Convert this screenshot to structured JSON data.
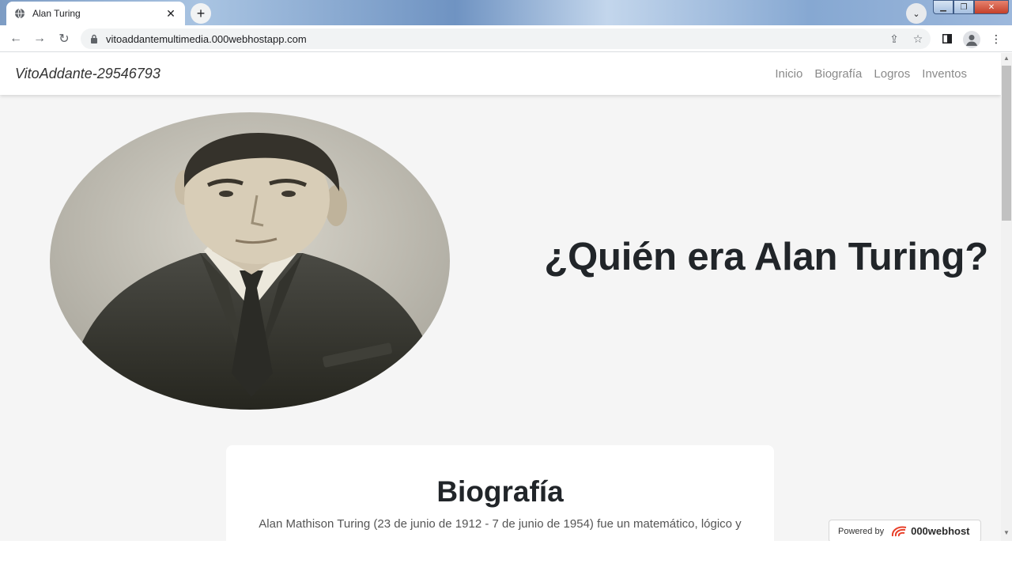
{
  "browser": {
    "tab_title": "Alan Turing",
    "tab_close": "✕",
    "new_tab": "+",
    "url": "vitoaddantemultimedia.000webhostapp.com"
  },
  "site": {
    "brand": "VitoAddante-29546793",
    "nav": [
      "Inicio",
      "Biografía",
      "Logros",
      "Inventos"
    ],
    "hero_title": "¿Quién era Alan Turing?",
    "bio_heading": "Biografía",
    "bio_text": "Alan Mathison Turing (23 de junio de 1912 - 7 de junio de 1954) fue un matemático, lógico y"
  },
  "badge": {
    "powered_by": "Powered by",
    "host_name": "000webhost"
  },
  "colors": {
    "page_bg": "#f5f5f5",
    "text_dark": "#212529",
    "nav_link": "#8a8a8a",
    "badge_accent": "#e8402a"
  },
  "icons": {
    "back": "arrow-left-icon",
    "forward": "arrow-right-icon",
    "reload": "reload-icon",
    "share": "share-icon",
    "bookmark": "star-icon",
    "side_panel": "side-panel-icon",
    "profile": "profile-icon",
    "menu": "kebab-menu-icon"
  }
}
